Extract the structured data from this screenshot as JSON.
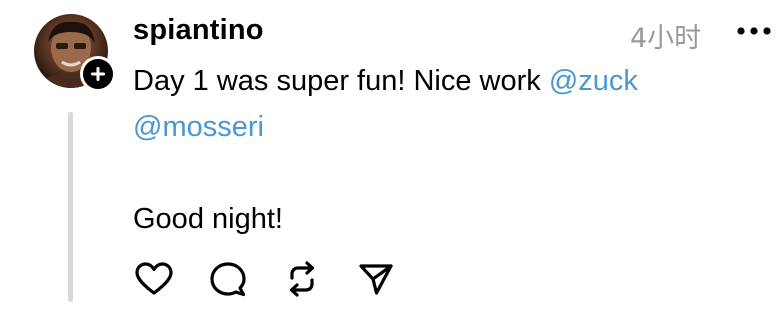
{
  "post": {
    "author": {
      "username": "spiantino"
    },
    "timestamp": "4小时",
    "content": {
      "line1_text": "Day 1 was super fun! Nice work ",
      "line1_mention": "@zuck",
      "line2_mention": "@mosseri",
      "line3_text": "",
      "line4_text": "Good night!"
    },
    "icons": {
      "follow": "plus-icon",
      "more": "more-horizontal-icon",
      "like": "heart-icon",
      "reply": "comment-icon",
      "repost": "repost-icon",
      "share": "send-icon"
    },
    "colors": {
      "mention": "#4a97d4",
      "timestamp": "#999999",
      "thread_line": "#d9d9d9",
      "text": "#000000"
    }
  }
}
